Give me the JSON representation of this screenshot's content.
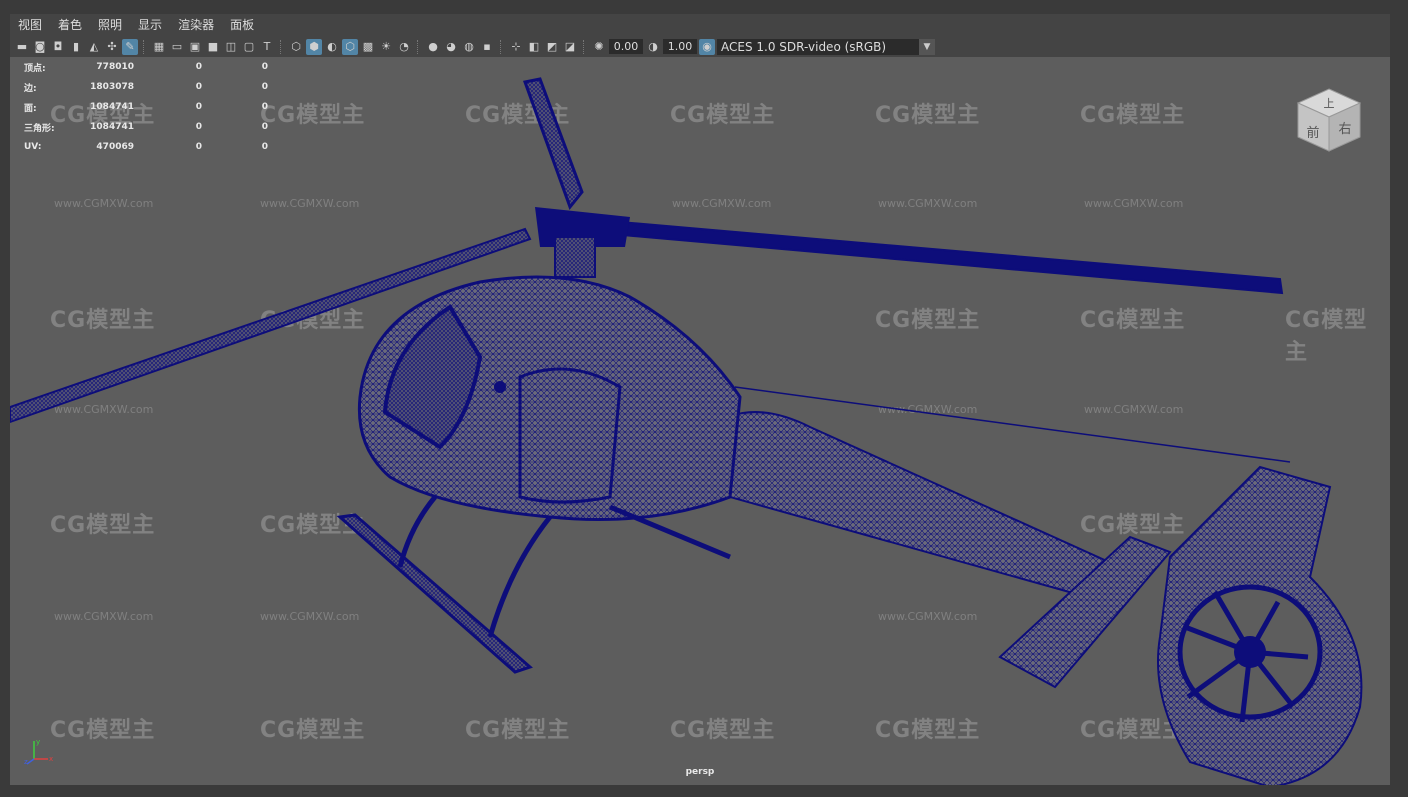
{
  "menu": {
    "items": [
      "视图",
      "着色",
      "照明",
      "显示",
      "渲染器",
      "面板"
    ]
  },
  "toolbar": {
    "exposure_value": "0.00",
    "gamma_value": "1.00",
    "color_space": "ACES 1.0 SDR-video (sRGB)"
  },
  "hud": {
    "rows": [
      {
        "label": "顶点:",
        "v1": "778010",
        "v2": "0",
        "v3": "0"
      },
      {
        "label": "边:",
        "v1": "1803078",
        "v2": "0",
        "v3": "0"
      },
      {
        "label": "面:",
        "v1": "1084741",
        "v2": "0",
        "v3": "0"
      },
      {
        "label": "三角形:",
        "v1": "1084741",
        "v2": "0",
        "v3": "0"
      },
      {
        "label": "UV:",
        "v1": "470069",
        "v2": "0",
        "v3": "0"
      }
    ]
  },
  "viewcube": {
    "top_label": "上",
    "front_label": "前",
    "right_label": "右"
  },
  "camera_label": "persp",
  "axis": {
    "x": "x",
    "y": "y",
    "z": "z"
  },
  "watermark": {
    "logo_text": "CG模型主",
    "url_text": "www.CGMXW.com"
  },
  "colors": {
    "wireframe": "#0d0d7a",
    "viewport_bg": "#5d5d5d",
    "accent": "#5285a6"
  }
}
